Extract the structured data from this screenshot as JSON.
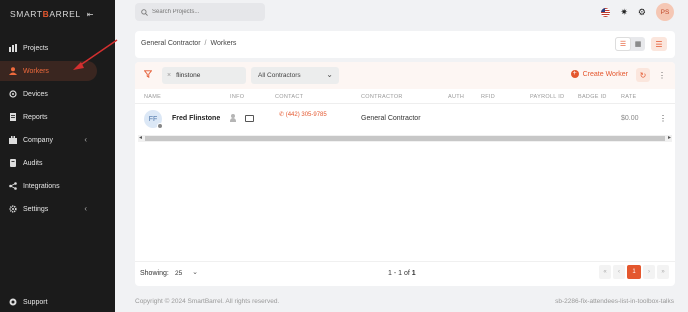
{
  "brand": {
    "prefix": "SMART",
    "highlight": "B",
    "suffix": "ARREL"
  },
  "sidebar": {
    "items": [
      {
        "label": "Projects"
      },
      {
        "label": "Workers"
      },
      {
        "label": "Devices"
      },
      {
        "label": "Reports"
      },
      {
        "label": "Company"
      },
      {
        "label": "Audits"
      },
      {
        "label": "Integrations"
      },
      {
        "label": "Settings"
      }
    ],
    "support": "Support"
  },
  "topbar": {
    "search_placeholder": "Search Projects...",
    "avatar_initials": "PS"
  },
  "breadcrumb": {
    "parent": "General Contractor",
    "separator": "/",
    "current": "Workers"
  },
  "filters": {
    "search_value": "flinstone",
    "contractor_select": "All Contractors",
    "create_label": "Create Worker"
  },
  "table": {
    "headers": [
      "NAME",
      "INFO",
      "CONTACT",
      "CONTRACTOR",
      "AUTH",
      "RFID",
      "PAYROLL ID",
      "BADGE ID",
      "RATE"
    ],
    "rows": [
      {
        "initials": "FF",
        "name": "Fred Flinstone",
        "phone": "(442) 305-9785",
        "contractor": "General Contractor",
        "rate": "$0.00"
      }
    ]
  },
  "footer": {
    "showing_label": "Showing:",
    "per_page": "25",
    "range_prefix": "1 - 1 of",
    "range_total": "1",
    "current_page": "1",
    "copyright": "Copyright © 2024 SmartBarrel. All rights reserved.",
    "branch": "sb-2286-fix-attendees-list-in-toolbox-talks"
  },
  "colors": {
    "accent": "#e4572e",
    "sidebar_bg": "#1b1b1b",
    "annotation_arrow": "#d32f2f"
  }
}
